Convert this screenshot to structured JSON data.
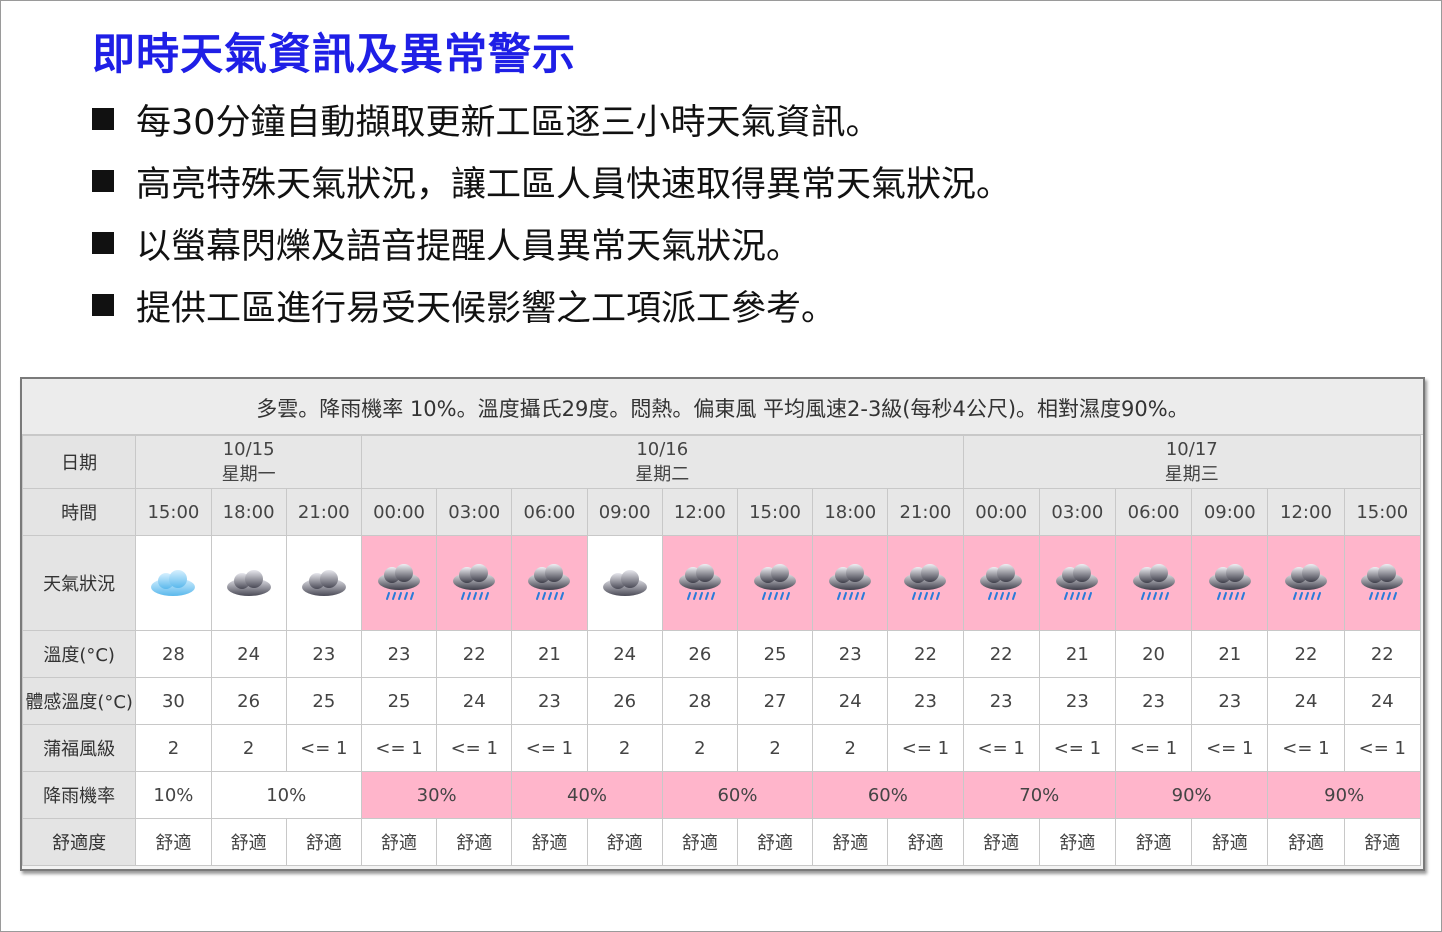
{
  "title": "即時天氣資訊及異常警示",
  "bullets": [
    "每30分鐘自動擷取更新工區逐三小時天氣資訊。",
    "高亮特殊天氣狀況，讓工區人員快速取得異常天氣狀況。",
    "以螢幕閃爍及語音提醒人員異常天氣狀況。",
    "提供工區進行易受天候影響之工項派工參考。"
  ],
  "widget": {
    "summary": "多雲。降雨機率 10%。溫度攝氏29度。悶熱。偏東風 平均風速2-3級(每秒4公尺)。相對濕度90%。",
    "highlight_color": "#ffb5cb",
    "row_labels": {
      "date": "日期",
      "time": "時間",
      "weather": "天氣狀況",
      "temp": "溫度(°C)",
      "feel": "體感溫度(°C)",
      "wind": "蒲福風級",
      "rain": "降雨機率",
      "comfort": "舒適度"
    },
    "dates": [
      {
        "date": "10/15",
        "weekday": "星期一",
        "span": 3
      },
      {
        "date": "10/16",
        "weekday": "星期二",
        "span": 8
      },
      {
        "date": "10/17",
        "weekday": "星期三",
        "span": 6
      }
    ],
    "columns": [
      {
        "time": "15:00",
        "icon": "partly-cloudy-icon",
        "alert": false,
        "temp": "28",
        "feel": "30",
        "wind": "2",
        "comfort": "舒適"
      },
      {
        "time": "18:00",
        "icon": "cloudy-icon",
        "alert": false,
        "temp": "24",
        "feel": "26",
        "wind": "2",
        "comfort": "舒適"
      },
      {
        "time": "21:00",
        "icon": "cloudy-icon",
        "alert": false,
        "temp": "23",
        "feel": "25",
        "wind": "<= 1",
        "comfort": "舒適"
      },
      {
        "time": "00:00",
        "icon": "rain-icon",
        "alert": true,
        "temp": "23",
        "feel": "25",
        "wind": "<= 1",
        "comfort": "舒適"
      },
      {
        "time": "03:00",
        "icon": "rain-icon",
        "alert": true,
        "temp": "22",
        "feel": "24",
        "wind": "<= 1",
        "comfort": "舒適"
      },
      {
        "time": "06:00",
        "icon": "rain-icon",
        "alert": true,
        "temp": "21",
        "feel": "23",
        "wind": "<= 1",
        "comfort": "舒適"
      },
      {
        "time": "09:00",
        "icon": "cloudy-icon",
        "alert": false,
        "temp": "24",
        "feel": "26",
        "wind": "2",
        "comfort": "舒適"
      },
      {
        "time": "12:00",
        "icon": "rain-icon",
        "alert": true,
        "temp": "26",
        "feel": "28",
        "wind": "2",
        "comfort": "舒適"
      },
      {
        "time": "15:00",
        "icon": "rain-icon",
        "alert": true,
        "temp": "25",
        "feel": "27",
        "wind": "2",
        "comfort": "舒適"
      },
      {
        "time": "18:00",
        "icon": "rain-icon",
        "alert": true,
        "temp": "23",
        "feel": "24",
        "wind": "2",
        "comfort": "舒適"
      },
      {
        "time": "21:00",
        "icon": "rain-icon",
        "alert": true,
        "temp": "22",
        "feel": "23",
        "wind": "<= 1",
        "comfort": "舒適"
      },
      {
        "time": "00:00",
        "icon": "rain-icon",
        "alert": true,
        "temp": "22",
        "feel": "23",
        "wind": "<= 1",
        "comfort": "舒適"
      },
      {
        "time": "03:00",
        "icon": "rain-icon",
        "alert": true,
        "temp": "21",
        "feel": "23",
        "wind": "<= 1",
        "comfort": "舒適"
      },
      {
        "time": "06:00",
        "icon": "rain-icon",
        "alert": true,
        "temp": "20",
        "feel": "23",
        "wind": "<= 1",
        "comfort": "舒適"
      },
      {
        "time": "09:00",
        "icon": "rain-icon",
        "alert": true,
        "temp": "21",
        "feel": "23",
        "wind": "<= 1",
        "comfort": "舒適"
      },
      {
        "time": "12:00",
        "icon": "rain-icon",
        "alert": true,
        "temp": "22",
        "feel": "24",
        "wind": "<= 1",
        "comfort": "舒適"
      },
      {
        "time": "15:00",
        "icon": "rain-icon",
        "alert": true,
        "temp": "22",
        "feel": "24",
        "wind": "<= 1",
        "comfort": "舒適"
      }
    ],
    "rain": [
      {
        "value": "10%",
        "span": 1,
        "alert": false
      },
      {
        "value": "10%",
        "span": 2,
        "alert": false
      },
      {
        "value": "30%",
        "span": 2,
        "alert": true
      },
      {
        "value": "40%",
        "span": 2,
        "alert": true
      },
      {
        "value": "60%",
        "span": 2,
        "alert": true
      },
      {
        "value": "60%",
        "span": 2,
        "alert": true
      },
      {
        "value": "70%",
        "span": 2,
        "alert": true
      },
      {
        "value": "90%",
        "span": 2,
        "alert": true
      },
      {
        "value": "90%",
        "span": 2,
        "alert": true
      }
    ]
  }
}
